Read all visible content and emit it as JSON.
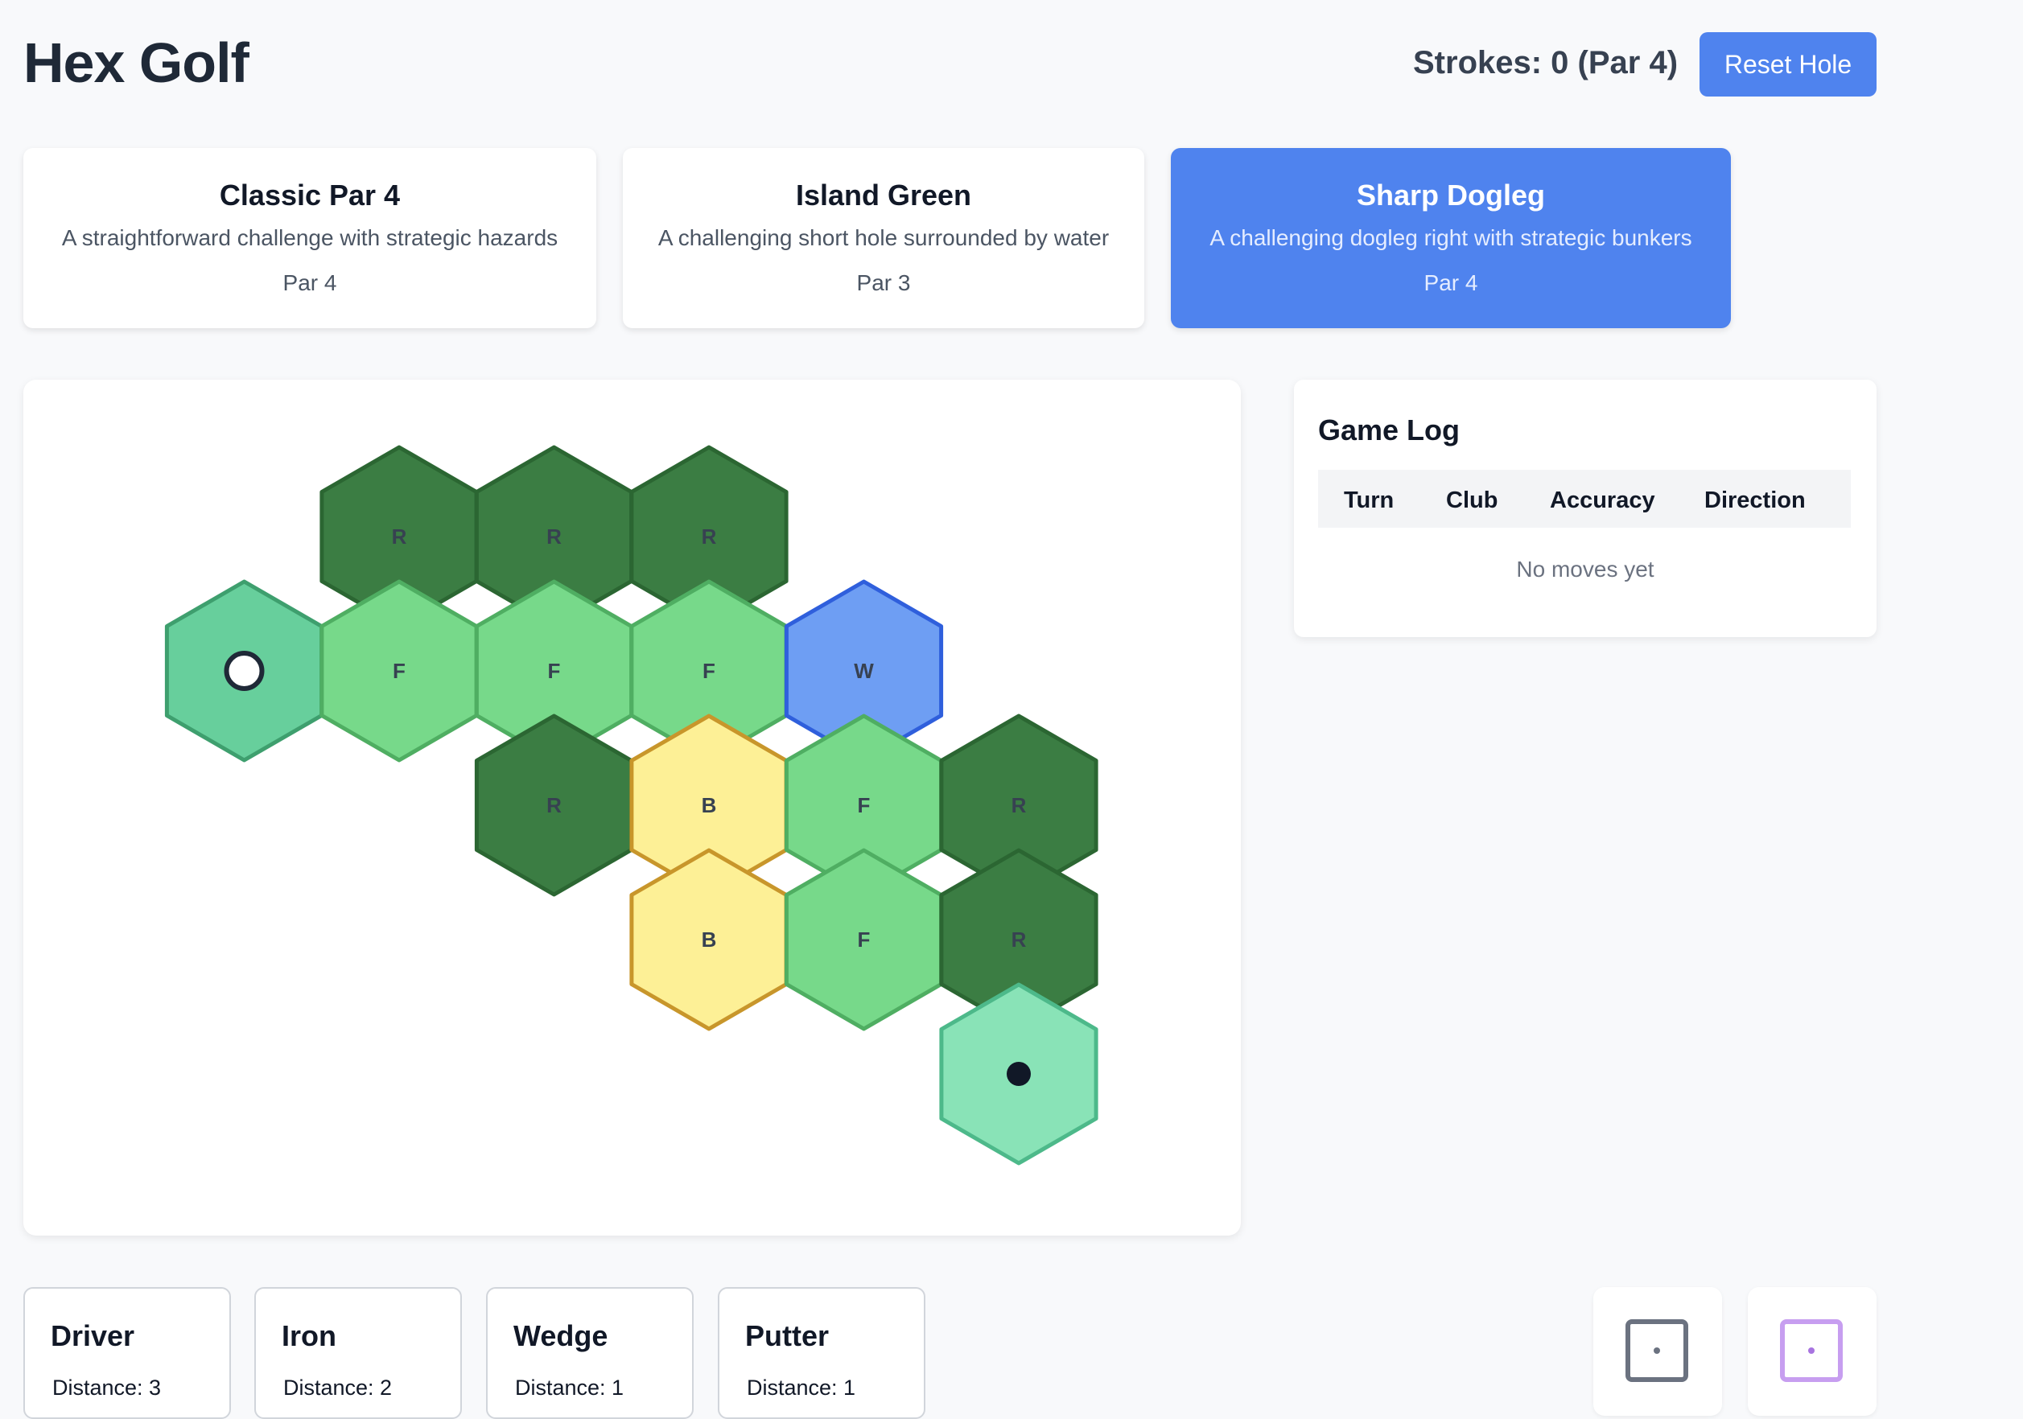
{
  "header": {
    "title": "Hex Golf",
    "strokes_text": "Strokes: 0 (Par 4)",
    "reset_label": "Reset Hole"
  },
  "holes": [
    {
      "name": "Classic Par 4",
      "description": "A straightforward challenge with strategic hazards",
      "par": "Par 4",
      "selected": false
    },
    {
      "name": "Island Green",
      "description": "A challenging short hole surrounded by water",
      "par": "Par 3",
      "selected": false
    },
    {
      "name": "Sharp Dogleg",
      "description": "A challenging dogleg right with strategic bunkers",
      "par": "Par 4",
      "selected": true
    }
  ],
  "terrain_colors": {
    "R": {
      "fill": "#3b7d43",
      "stroke": "#2b6632"
    },
    "F": {
      "fill": "#77d98a",
      "stroke": "#4fae62"
    },
    "W": {
      "fill": "#6e9ef3",
      "stroke": "#2f5fdc"
    },
    "B": {
      "fill": "#fdf096",
      "stroke": "#c8962b"
    },
    "T": {
      "fill": "#67cf9c",
      "stroke": "#3e9f6e"
    },
    "G": {
      "fill": "#89e3b7",
      "stroke": "#4db98a"
    }
  },
  "board": {
    "tiles": [
      {
        "row": 0,
        "col": 1,
        "label": "R",
        "terrain": "R"
      },
      {
        "row": 0,
        "col": 2,
        "label": "R",
        "terrain": "R"
      },
      {
        "row": 0,
        "col": 3,
        "label": "R",
        "terrain": "R"
      },
      {
        "row": 1,
        "col": 0,
        "label": "",
        "terrain": "T",
        "marker": "ball"
      },
      {
        "row": 1,
        "col": 1,
        "label": "F",
        "terrain": "F"
      },
      {
        "row": 1,
        "col": 2,
        "label": "F",
        "terrain": "F"
      },
      {
        "row": 1,
        "col": 3,
        "label": "F",
        "terrain": "F"
      },
      {
        "row": 1,
        "col": 4,
        "label": "W",
        "terrain": "W"
      },
      {
        "row": 2,
        "col": 2,
        "label": "R",
        "terrain": "R"
      },
      {
        "row": 2,
        "col": 3,
        "label": "B",
        "terrain": "B"
      },
      {
        "row": 2,
        "col": 4,
        "label": "F",
        "terrain": "F"
      },
      {
        "row": 2,
        "col": 5,
        "label": "R",
        "terrain": "R"
      },
      {
        "row": 3,
        "col": 3,
        "label": "B",
        "terrain": "B"
      },
      {
        "row": 3,
        "col": 4,
        "label": "F",
        "terrain": "F"
      },
      {
        "row": 3,
        "col": 5,
        "label": "R",
        "terrain": "R"
      },
      {
        "row": 4,
        "col": 5,
        "label": "",
        "terrain": "G",
        "marker": "hole"
      }
    ]
  },
  "game_log": {
    "title": "Game Log",
    "columns": [
      "Turn",
      "Club",
      "Accuracy",
      "Direction"
    ],
    "empty_text": "No moves yet"
  },
  "clubs": [
    {
      "name": "Driver",
      "distance": "Distance: 3"
    },
    {
      "name": "Iron",
      "distance": "Distance: 2"
    },
    {
      "name": "Wedge",
      "distance": "Distance: 1"
    },
    {
      "name": "Putter",
      "distance": "Distance: 1"
    }
  ],
  "dice": [
    {
      "name": "accuracy-die",
      "color": "#6b7280",
      "pip_color": "#6b7280"
    },
    {
      "name": "direction-die",
      "color": "#c79ef0",
      "pip_color": "#a874e0"
    }
  ]
}
